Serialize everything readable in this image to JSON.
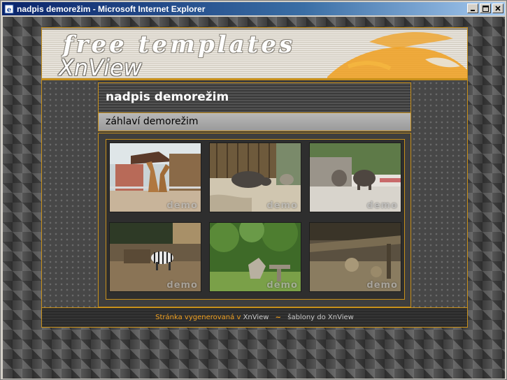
{
  "window": {
    "title": "nadpis demorežim - Microsoft Internet Explorer",
    "controls": {
      "minimize": "_",
      "maximize": "□",
      "close": "×"
    }
  },
  "banner": {
    "line1": "free templates",
    "line2": "XnView"
  },
  "page": {
    "heading": "nadpis demorežim",
    "subheading": "záhlaví demorežim"
  },
  "gallery": {
    "watermark": "demo",
    "thumbnails": [
      {
        "name": "giraffes"
      },
      {
        "name": "rhino"
      },
      {
        "name": "elephants"
      },
      {
        "name": "zebra"
      },
      {
        "name": "forest-sculpture"
      },
      {
        "name": "enclosure"
      }
    ]
  },
  "footer": {
    "prefix": "Stránka vygenerovaná v",
    "link1": "XnView",
    "separator": "~",
    "suffix": "šablony do XnView"
  },
  "colors": {
    "accent": "#c8901a",
    "titlebar_start": "#0a246a",
    "titlebar_end": "#a6caf0"
  }
}
